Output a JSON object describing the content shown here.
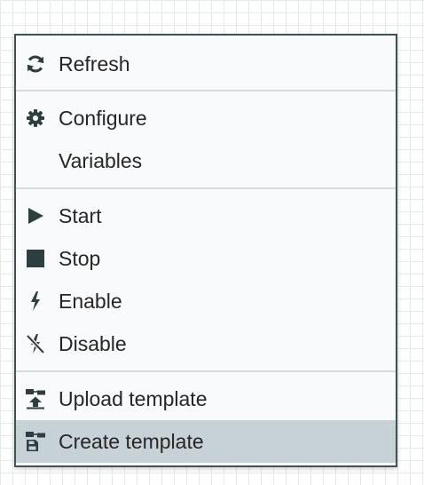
{
  "context_menu": {
    "items": [
      {
        "label": "Refresh",
        "icon": "refresh-icon"
      },
      {
        "label": "Configure",
        "icon": "gear-icon"
      },
      {
        "label": "Variables",
        "icon": ""
      },
      {
        "label": "Start",
        "icon": "play-icon"
      },
      {
        "label": "Stop",
        "icon": "stop-icon"
      },
      {
        "label": "Enable",
        "icon": "bolt-icon"
      },
      {
        "label": "Disable",
        "icon": "bolt-slash-icon"
      },
      {
        "label": "Upload template",
        "icon": "upload-template-icon"
      },
      {
        "label": "Create template",
        "icon": "create-template-icon"
      }
    ],
    "highlighted_item": "Create template",
    "colors": {
      "menu_border": "#3d5355",
      "menu_background": "#f9fafb",
      "highlight_background": "#c7d2d7",
      "icon_color": "#2c3e3f",
      "text_color": "#262626",
      "canvas_grid": "#e6e9ea"
    }
  }
}
